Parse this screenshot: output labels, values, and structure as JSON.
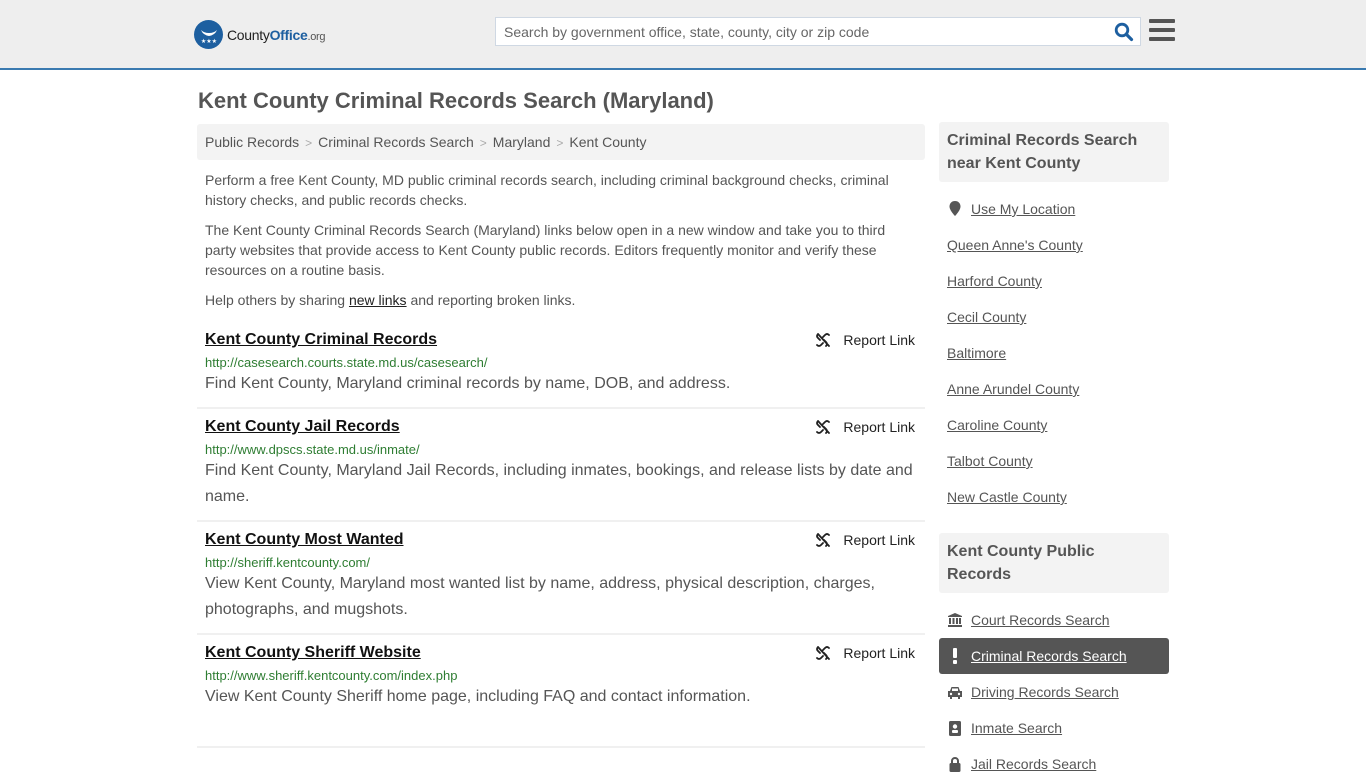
{
  "header": {
    "logo": {
      "name_part1": "County",
      "name_part2": "Office",
      "tld": ".org"
    },
    "search": {
      "placeholder": "Search by government office, state, county, city or zip code",
      "value": ""
    },
    "icons": {
      "search": "search-icon",
      "menu": "hamburger-menu-icon"
    }
  },
  "page": {
    "title": "Kent County Criminal Records Search (Maryland)",
    "breadcrumb": [
      "Public Records",
      "Criminal Records Search",
      "Maryland",
      "Kent County"
    ],
    "intro": {
      "p1": "Perform a free Kent County, MD public criminal records search, including criminal background checks, criminal history checks, and public records checks.",
      "p2": "The Kent County Criminal Records Search (Maryland) links below open in a new window and take you to third party websites that provide access to Kent County public records. Editors frequently monitor and verify these resources on a routine basis.",
      "p3_before": "Help others by sharing ",
      "p3_link": "new links",
      "p3_after": " and reporting broken links."
    }
  },
  "results": [
    {
      "title": "Kent County Criminal Records",
      "url": "http://casesearch.courts.state.md.us/casesearch/",
      "description": "Find Kent County, Maryland criminal records by name, DOB, and address.",
      "report_label": "Report Link"
    },
    {
      "title": "Kent County Jail Records",
      "url": "http://www.dpscs.state.md.us/inmate/",
      "description": "Find Kent County, Maryland Jail Records, including inmates, bookings, and release lists by date and name.",
      "report_label": "Report Link"
    },
    {
      "title": "Kent County Most Wanted",
      "url": "http://sheriff.kentcounty.com/",
      "description": "View Kent County, Maryland most wanted list by name, address, physical description, charges, photographs, and mugshots.",
      "report_label": "Report Link"
    },
    {
      "title": "Kent County Sheriff Website",
      "url": "http://www.sheriff.kentcounty.com/index.php",
      "description": "View Kent County Sheriff home page, including FAQ and contact information.",
      "report_label": "Report Link"
    }
  ],
  "sidebar": {
    "nearby": {
      "heading": "Criminal Records Search near Kent County",
      "use_location": "Use My Location",
      "items": [
        "Queen Anne's County",
        "Harford County",
        "Cecil County",
        "Baltimore",
        "Anne Arundel County",
        "Caroline County",
        "Talbot County",
        "New Castle County"
      ]
    },
    "public_records": {
      "heading": "Kent County Public Records",
      "items": [
        {
          "label": "Court Records Search",
          "icon": "courthouse-icon",
          "active": false
        },
        {
          "label": "Criminal Records Search",
          "icon": "exclamation-icon",
          "active": true
        },
        {
          "label": "Driving Records Search",
          "icon": "car-icon",
          "active": false
        },
        {
          "label": "Inmate Search",
          "icon": "id-badge-icon",
          "active": false
        },
        {
          "label": "Jail Records Search",
          "icon": "lock-icon",
          "active": false
        }
      ]
    }
  },
  "colors": {
    "accent": "#1d5fa0",
    "header_border": "#3a7ab0",
    "url_green": "#2e7d32",
    "active_bg": "#555555"
  }
}
